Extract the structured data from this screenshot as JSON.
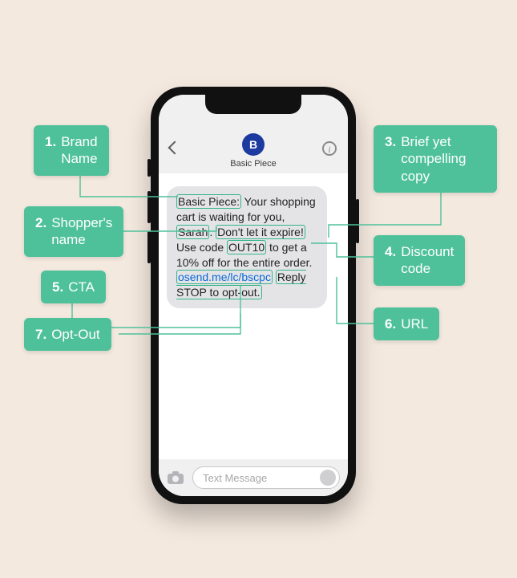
{
  "annotations": {
    "l1": {
      "num": "1.",
      "txt": "Brand\nName"
    },
    "l2": {
      "num": "2.",
      "txt": "Shopper's\nname"
    },
    "l3": {
      "num": "3.",
      "txt": "Brief yet\ncompelling\ncopy"
    },
    "l4": {
      "num": "4.",
      "txt": "Discount\ncode"
    },
    "l5": {
      "num": "5.",
      "txt": "CTA"
    },
    "l6": {
      "num": "6.",
      "txt": "URL"
    },
    "l7": {
      "num": "7.",
      "txt": "Opt-Out"
    }
  },
  "phone": {
    "header": {
      "avatar_initial": "B",
      "contact_name": "Basic Piece"
    },
    "message": {
      "brand": "Basic Piece:",
      "seg1": " Your shopping cart is waiting for you, ",
      "shopper": "Sarah",
      "seg2_a": ". ",
      "brief_copy": "Don't let it expire!",
      "seg2_b": " Use code ",
      "code": "OUT10",
      "seg3": " to get a 10% off for the entire order. ",
      "url": "osend.me/lc/bscpc",
      "seg4": " ",
      "optout": "Reply STOP to opt-out."
    },
    "input_placeholder": "Text Message"
  },
  "colors": {
    "accent": "#4ec19a",
    "bg": "#f4e9df",
    "avatar": "#1d3aa0"
  }
}
